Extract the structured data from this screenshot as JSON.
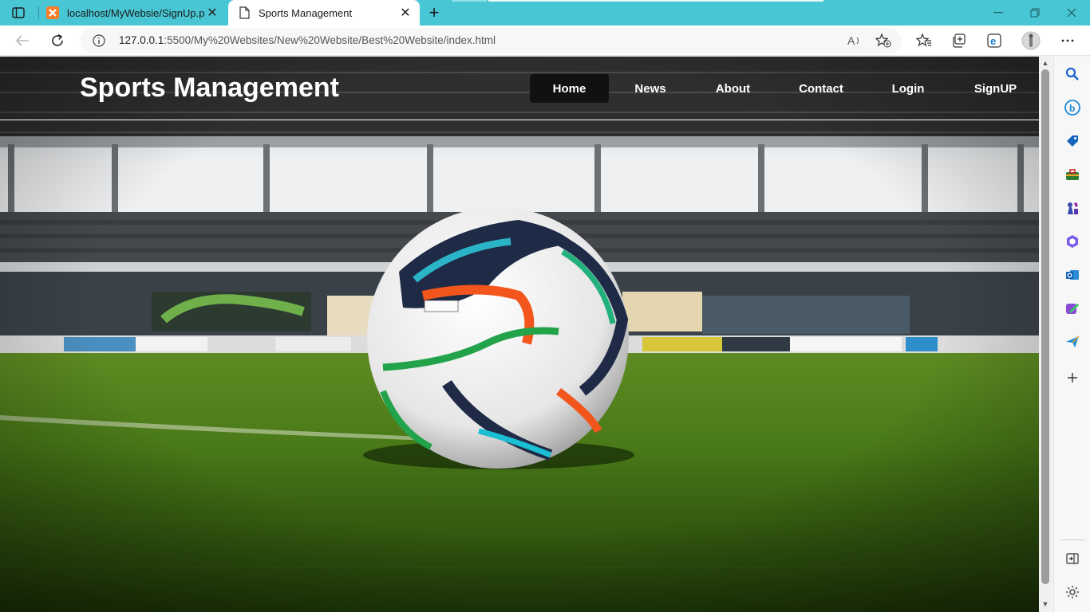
{
  "browser": {
    "tabs": [
      {
        "title": "localhost/MyWebsie/SignUp.php",
        "active": false
      },
      {
        "title": "Sports Management",
        "active": true
      }
    ],
    "address_bar": {
      "url_host": "127.0.0.1",
      "url_rest": ":5500/My%20Websites/New%20Website/Best%20Website/index.html"
    },
    "accent_color": "#49c6d4"
  },
  "site": {
    "logo": "Sports Management",
    "nav": [
      {
        "label": "Home",
        "active": true
      },
      {
        "label": "News",
        "active": false
      },
      {
        "label": "About",
        "active": false
      },
      {
        "label": "Contact",
        "active": false
      },
      {
        "label": "Login",
        "active": false
      },
      {
        "label": "SignUP",
        "active": false
      }
    ],
    "hero_image": "soccer-ball-on-stadium-grass"
  },
  "sidebar_icons": [
    "search-icon",
    "bing-icon",
    "shopping-tag-icon",
    "tools-icon",
    "games-icon",
    "m365-icon",
    "outlook-icon",
    "designer-icon",
    "send-icon",
    "add-icon",
    "split-screen-icon",
    "settings-icon"
  ]
}
